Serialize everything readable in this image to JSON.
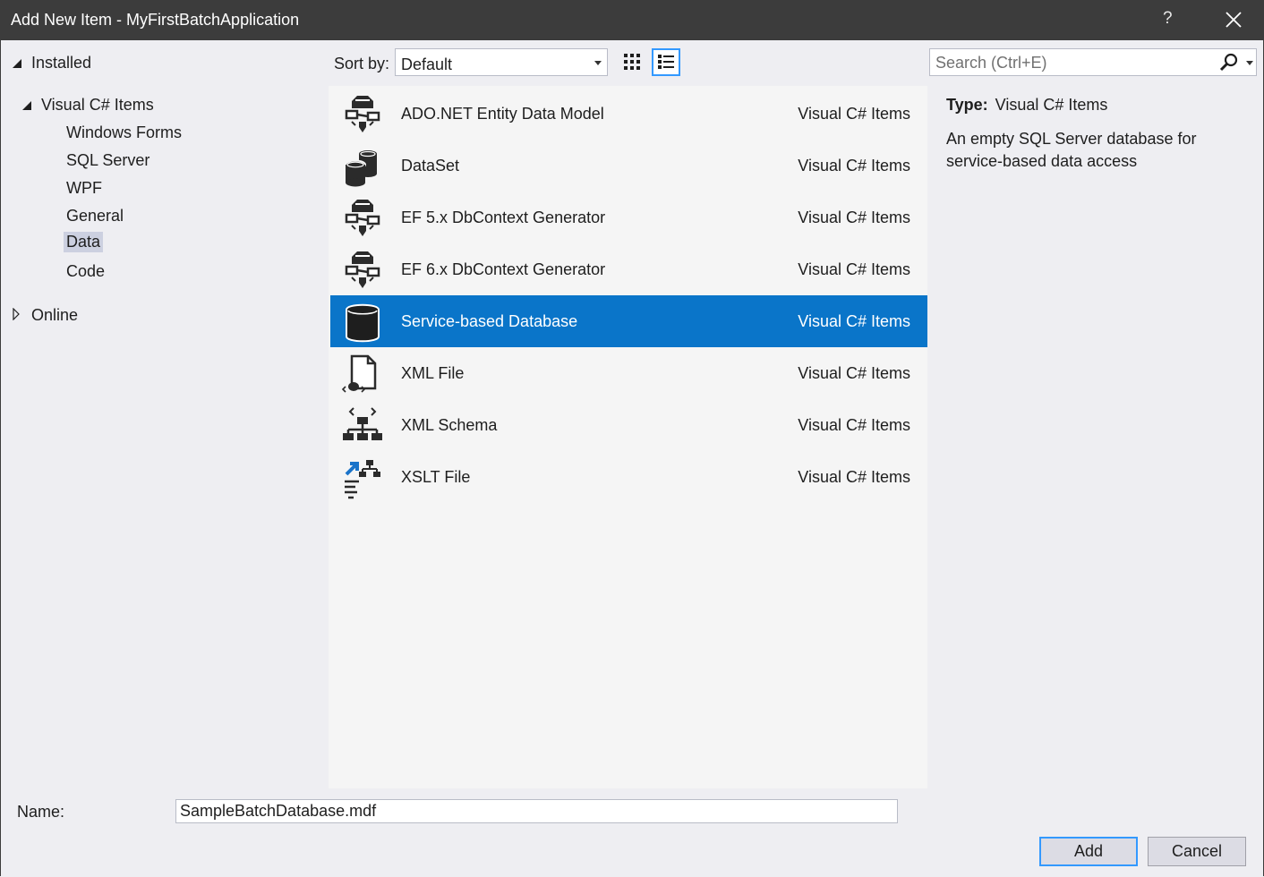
{
  "window": {
    "title": "Add New Item - MyFirstBatchApplication",
    "help_label": "?"
  },
  "tree": {
    "installed": "Installed",
    "visual_csharp": "Visual C# Items",
    "children": [
      "Windows Forms",
      "SQL Server",
      "WPF",
      "General",
      "Data",
      "Code"
    ],
    "selected": "Data",
    "online": "Online"
  },
  "toolbar": {
    "sort_label": "Sort by:",
    "sort_value": "Default"
  },
  "search": {
    "placeholder": "Search (Ctrl+E)"
  },
  "items": [
    {
      "name": "ADO.NET Entity Data Model",
      "category": "Visual C# Items",
      "icon": "entity-model-icon"
    },
    {
      "name": "DataSet",
      "category": "Visual C# Items",
      "icon": "dataset-icon"
    },
    {
      "name": "EF 5.x DbContext Generator",
      "category": "Visual C# Items",
      "icon": "entity-model-icon"
    },
    {
      "name": "EF 6.x DbContext Generator",
      "category": "Visual C# Items",
      "icon": "entity-model-icon"
    },
    {
      "name": "Service-based Database",
      "category": "Visual C# Items",
      "icon": "database-icon",
      "selected": true
    },
    {
      "name": "XML File",
      "category": "Visual C# Items",
      "icon": "xml-file-icon"
    },
    {
      "name": "XML Schema",
      "category": "Visual C# Items",
      "icon": "xml-schema-icon"
    },
    {
      "name": "XSLT File",
      "category": "Visual C# Items",
      "icon": "xslt-file-icon"
    }
  ],
  "details": {
    "type_label": "Type:",
    "type_value": "Visual C# Items",
    "description": "An empty SQL Server database for service-based data access"
  },
  "form": {
    "name_label": "Name:",
    "name_value": "SampleBatchDatabase.mdf",
    "add_label": "Add",
    "cancel_label": "Cancel"
  },
  "colors": {
    "selection": "#0a75c9",
    "accent": "#3399ff",
    "titlebar": "#3c3c3c"
  }
}
